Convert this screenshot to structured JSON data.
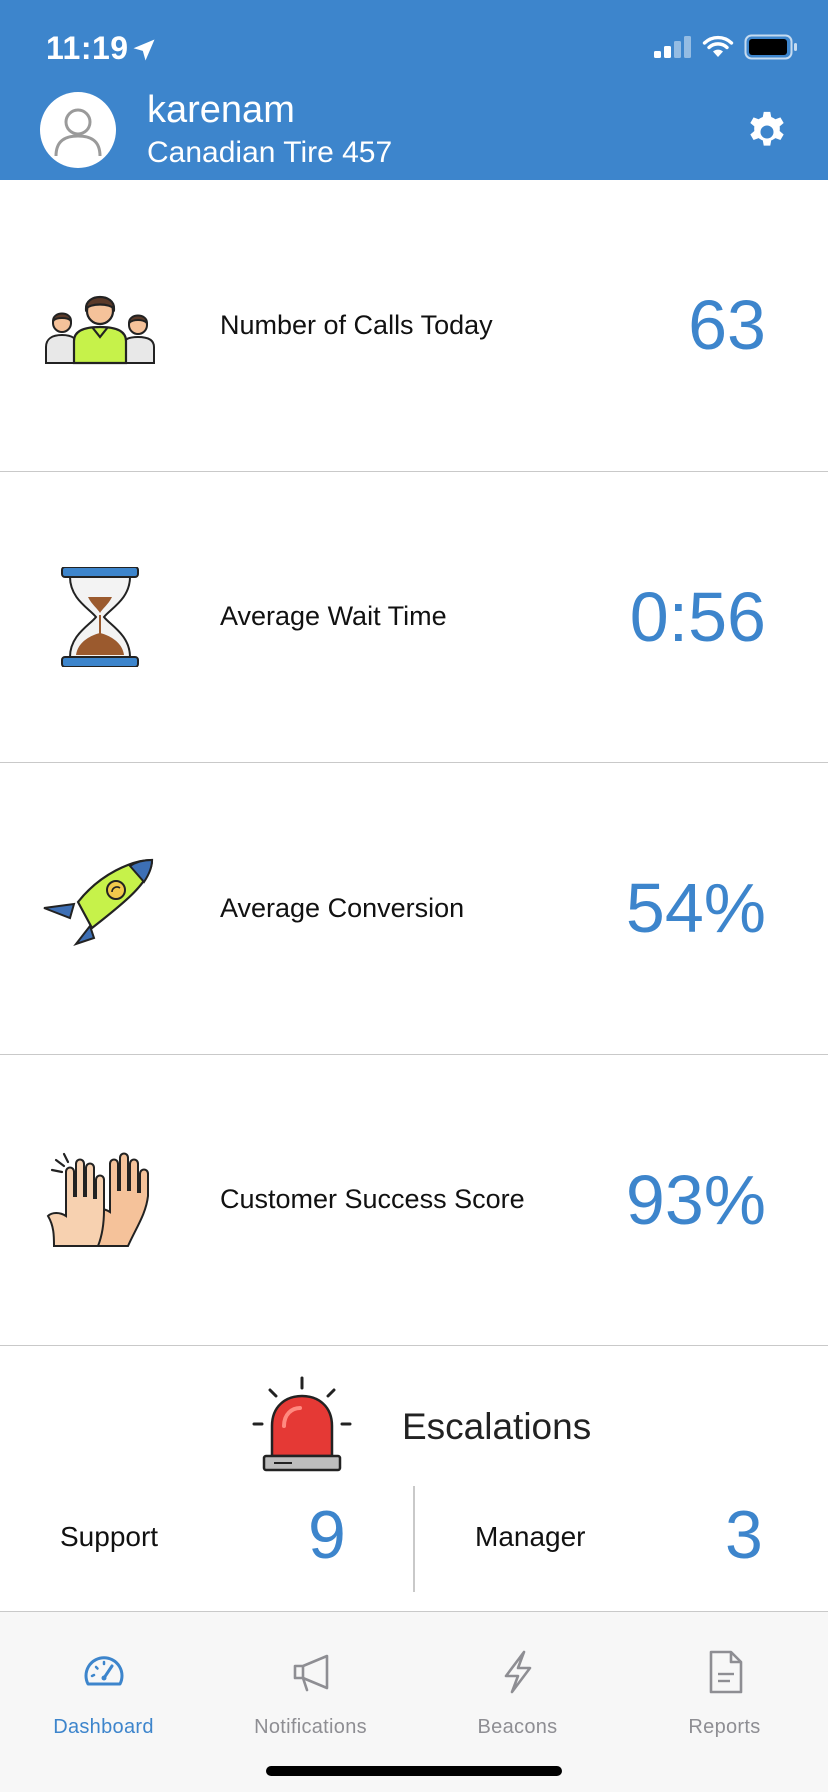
{
  "status_bar": {
    "time": "11:19"
  },
  "user": {
    "username": "karenam",
    "store": "Canadian Tire 457"
  },
  "metrics": [
    {
      "label": "Number of Calls Today",
      "value": "63",
      "icon": "team-icon"
    },
    {
      "label": "Average Wait Time",
      "value": "0:56",
      "icon": "hourglass-icon"
    },
    {
      "label": "Average Conversion",
      "value": "54%",
      "icon": "rocket-icon"
    },
    {
      "label": "Customer Success Score",
      "value": "93%",
      "icon": "clapping-hands-icon"
    }
  ],
  "escalations": {
    "title": "Escalations",
    "icon": "siren-icon",
    "support_label": "Support",
    "support_value": "9",
    "manager_label": "Manager",
    "manager_value": "3"
  },
  "tabs": [
    {
      "label": "Dashboard",
      "icon": "speedometer-icon",
      "active": true
    },
    {
      "label": "Notifications",
      "icon": "megaphone-icon",
      "active": false
    },
    {
      "label": "Beacons",
      "icon": "lightning-icon",
      "active": false
    },
    {
      "label": "Reports",
      "icon": "document-icon",
      "active": false
    }
  ],
  "colors": {
    "header": "#3d85cc",
    "accent": "#3d85cc",
    "tab_inactive": "#8e8e93"
  }
}
